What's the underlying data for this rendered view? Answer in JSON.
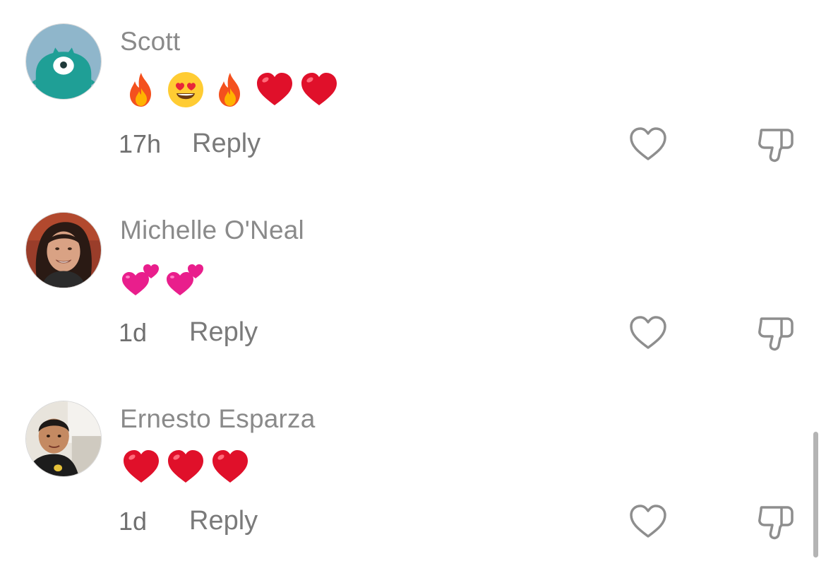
{
  "comments": [
    {
      "username": "Scott",
      "avatar": "teal-monster-avatar",
      "emojis": [
        "fire",
        "heart-eyes",
        "fire",
        "red-heart",
        "red-heart"
      ],
      "time": "17h",
      "reply_label": "Reply"
    },
    {
      "username": "Michelle O'Neal",
      "avatar": "woman-photo-avatar",
      "emojis": [
        "two-hearts",
        "two-hearts"
      ],
      "time": "1d",
      "reply_label": "Reply"
    },
    {
      "username": "Ernesto Esparza",
      "avatar": "man-photo-avatar",
      "emojis": [
        "red-heart",
        "red-heart",
        "red-heart"
      ],
      "time": "1d",
      "reply_label": "Reply"
    }
  ],
  "icons": {
    "like": "heart-outline-icon",
    "dislike": "thumbs-down-icon"
  },
  "colors": {
    "username": "#8a8a8a",
    "meta": "#707070",
    "icon_stroke": "#8e8e8e",
    "scrollbar": "#b4b4b4"
  }
}
